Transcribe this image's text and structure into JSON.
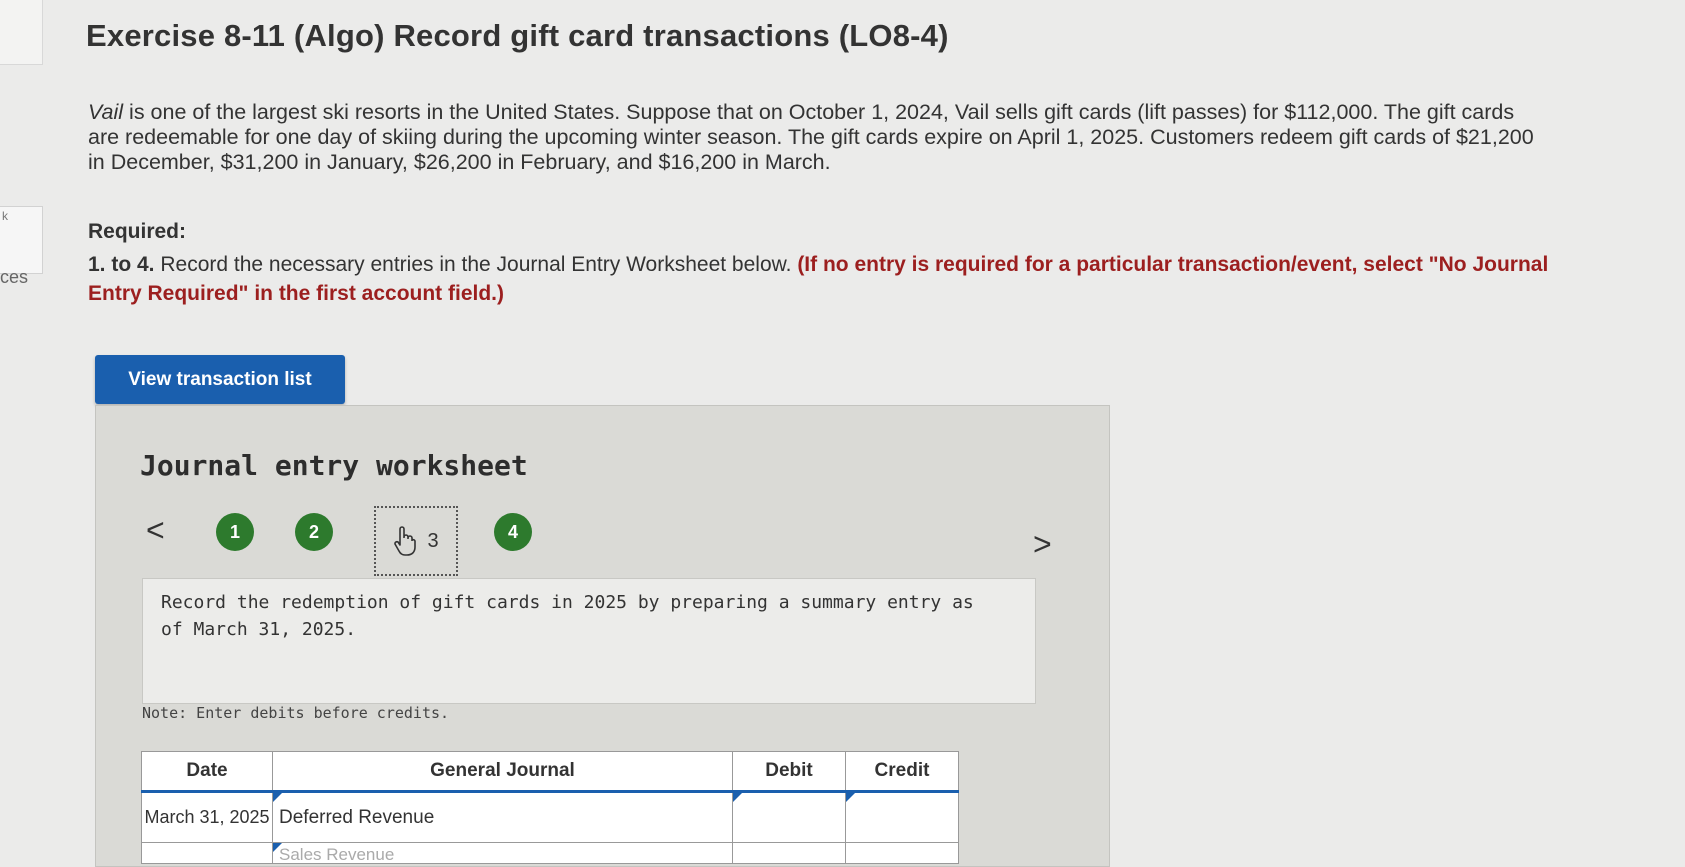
{
  "sidebar": {
    "mark": "k",
    "label": "ces"
  },
  "page_title": "Exercise 8-11 (Algo) Record gift card transactions (LO8-4)",
  "intro": {
    "company_italic": "Vail",
    "text": " is one of the largest ski resorts in the United States. Suppose that on October 1, 2024, Vail sells gift cards (lift passes) for $112,000. The gift cards are redeemable for one day of skiing during the upcoming winter season. The gift cards expire on April 1, 2025. Customers redeem gift cards of $21,200 in December, $31,200 in January, $26,200 in February, and $16,200 in March."
  },
  "required_heading": "Required:",
  "instructions": {
    "prefix": "1. to 4.",
    "text": " Record the necessary entries in the Journal Entry Worksheet below. ",
    "emphasis": "(If no entry is required for a particular transaction/event, select \"No Journal Entry Required\" in the first account field.)"
  },
  "view_button_label": "View transaction list",
  "worksheet": {
    "title": "Journal entry worksheet",
    "prev_glyph": "<",
    "next_glyph": ">",
    "steps": [
      "1",
      "2",
      "3",
      "4"
    ],
    "current_step": "3",
    "task": "Record the redemption of gift cards in 2025 by preparing a summary entry as of March 31, 2025.",
    "note": "Note: Enter debits before credits.",
    "table": {
      "headers": {
        "date": "Date",
        "journal": "General Journal",
        "debit": "Debit",
        "credit": "Credit"
      },
      "rows": [
        {
          "date": "March 31, 2025",
          "account": "Deferred Revenue",
          "debit": "",
          "credit": ""
        },
        {
          "date": "",
          "account": "Sales Revenue",
          "debit": "",
          "credit": ""
        }
      ]
    }
  },
  "colors": {
    "accent_blue": "#1a5fae",
    "step_green": "#2d7a2d",
    "emphasis_red": "#9c1f1f"
  },
  "icons": {
    "current_step": "hand-pointer-icon"
  }
}
